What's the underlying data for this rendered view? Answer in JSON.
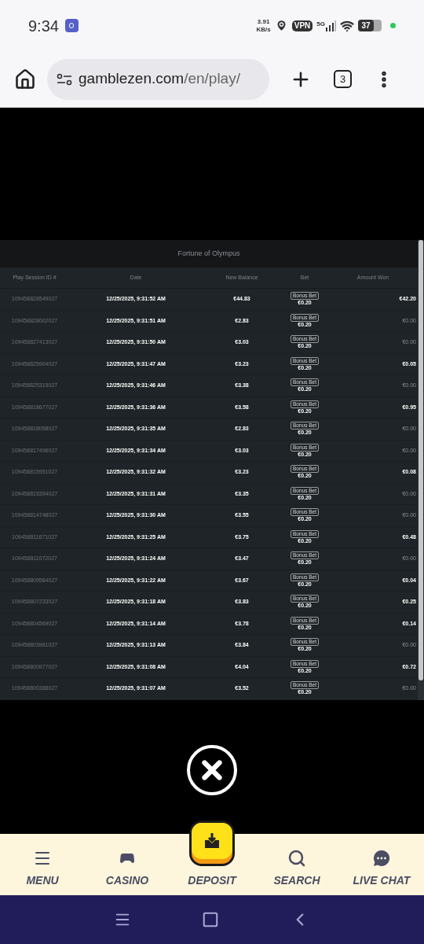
{
  "status_bar": {
    "time": "9:34",
    "net_speed": "3.91",
    "net_unit": "KB/s",
    "vpn": "VPN",
    "network": "5G",
    "battery": "37"
  },
  "browser": {
    "url_domain": "gamblezen.com",
    "url_path": "/en/play/",
    "tab_count": "3"
  },
  "table": {
    "title": "Fortune of Olympus",
    "columns": [
      "Play Session ID #",
      "Date",
      "New Balance",
      "Bet",
      "Amount Won"
    ],
    "rows": [
      {
        "id": "109458828549027",
        "date": "12/25/2025, 9:31:52 AM",
        "balance": "€44.83",
        "badge": "Bonus Bet",
        "bet": "€0.20",
        "won": "€42.20",
        "muted": false
      },
      {
        "id": "109458828002027",
        "date": "12/25/2025, 9:31:51 AM",
        "balance": "€2.83",
        "badge": "Bonus Bet",
        "bet": "€0.20",
        "won": "€0.00",
        "muted": true
      },
      {
        "id": "109458827413027",
        "date": "12/25/2025, 9:31:50 AM",
        "balance": "€3.03",
        "badge": "Bonus Bet",
        "bet": "€0.20",
        "won": "€0.00",
        "muted": true
      },
      {
        "id": "109458825904027",
        "date": "12/25/2025, 9:31:47 AM",
        "balance": "€3.23",
        "badge": "Bonus Bet",
        "bet": "€0.20",
        "won": "€0.05",
        "muted": false
      },
      {
        "id": "109458825315027",
        "date": "12/25/2025, 9:31:46 AM",
        "balance": "€3.38",
        "badge": "Bonus Bet",
        "bet": "€0.20",
        "won": "€0.00",
        "muted": true
      },
      {
        "id": "109458818677027",
        "date": "12/25/2025, 9:31:36 AM",
        "balance": "€3.58",
        "badge": "Bonus Bet",
        "bet": "€0.20",
        "won": "€0.95",
        "muted": false
      },
      {
        "id": "109458818058027",
        "date": "12/25/2025, 9:31:35 AM",
        "balance": "€2.83",
        "badge": "Bonus Bet",
        "bet": "€0.20",
        "won": "€0.00",
        "muted": true
      },
      {
        "id": "109458817496027",
        "date": "12/25/2025, 9:31:34 AM",
        "balance": "€3.03",
        "badge": "Bonus Bet",
        "bet": "€0.20",
        "won": "€0.00",
        "muted": true
      },
      {
        "id": "109458815951027",
        "date": "12/25/2025, 9:31:32 AM",
        "balance": "€3.23",
        "badge": "Bonus Bet",
        "bet": "€0.20",
        "won": "€0.08",
        "muted": false
      },
      {
        "id": "109458815394027",
        "date": "12/25/2025, 9:31:31 AM",
        "balance": "€3.35",
        "badge": "Bonus Bet",
        "bet": "€0.20",
        "won": "€0.00",
        "muted": true
      },
      {
        "id": "109458814748027",
        "date": "12/25/2025, 9:31:30 AM",
        "balance": "€3.55",
        "badge": "Bonus Bet",
        "bet": "€0.20",
        "won": "€0.00",
        "muted": true
      },
      {
        "id": "109458811671027",
        "date": "12/25/2025, 9:31:25 AM",
        "balance": "€3.75",
        "badge": "Bonus Bet",
        "bet": "€0.20",
        "won": "€0.48",
        "muted": false
      },
      {
        "id": "109458811072027",
        "date": "12/25/2025, 9:31:24 AM",
        "balance": "€3.47",
        "badge": "Bonus Bet",
        "bet": "€0.20",
        "won": "€0.00",
        "muted": true
      },
      {
        "id": "109458809584027",
        "date": "12/25/2025, 9:31:22 AM",
        "balance": "€3.67",
        "badge": "Bonus Bet",
        "bet": "€0.20",
        "won": "€0.04",
        "muted": false
      },
      {
        "id": "109458807233027",
        "date": "12/25/2025, 9:31:18 AM",
        "balance": "€3.83",
        "badge": "Bonus Bet",
        "bet": "€0.20",
        "won": "€0.25",
        "muted": false
      },
      {
        "id": "109458804569027",
        "date": "12/25/2025, 9:31:14 AM",
        "balance": "€3.78",
        "badge": "Bonus Bet",
        "bet": "€0.20",
        "won": "€0.14",
        "muted": false
      },
      {
        "id": "109458803961027",
        "date": "12/25/2025, 9:31:13 AM",
        "balance": "€3.84",
        "badge": "Bonus Bet",
        "bet": "€0.20",
        "won": "€0.00",
        "muted": true
      },
      {
        "id": "109458800977027",
        "date": "12/25/2025, 9:31:08 AM",
        "balance": "€4.04",
        "badge": "Bonus Bet",
        "bet": "€0.20",
        "won": "€0.72",
        "muted": false
      },
      {
        "id": "109458800388027",
        "date": "12/25/2025, 9:31:07 AM",
        "balance": "€3.52",
        "badge": "Bonus Bet",
        "bet": "€0.20",
        "won": "€0.00",
        "muted": true
      }
    ]
  },
  "bottom_nav": [
    {
      "kind": "menu",
      "label": "MENU"
    },
    {
      "kind": "casino",
      "label": "CASINO"
    },
    {
      "kind": "deposit",
      "label": "DEPOSIT"
    },
    {
      "kind": "search",
      "label": "SEARCH"
    },
    {
      "kind": "chat",
      "label": "LIVE CHAT"
    }
  ]
}
